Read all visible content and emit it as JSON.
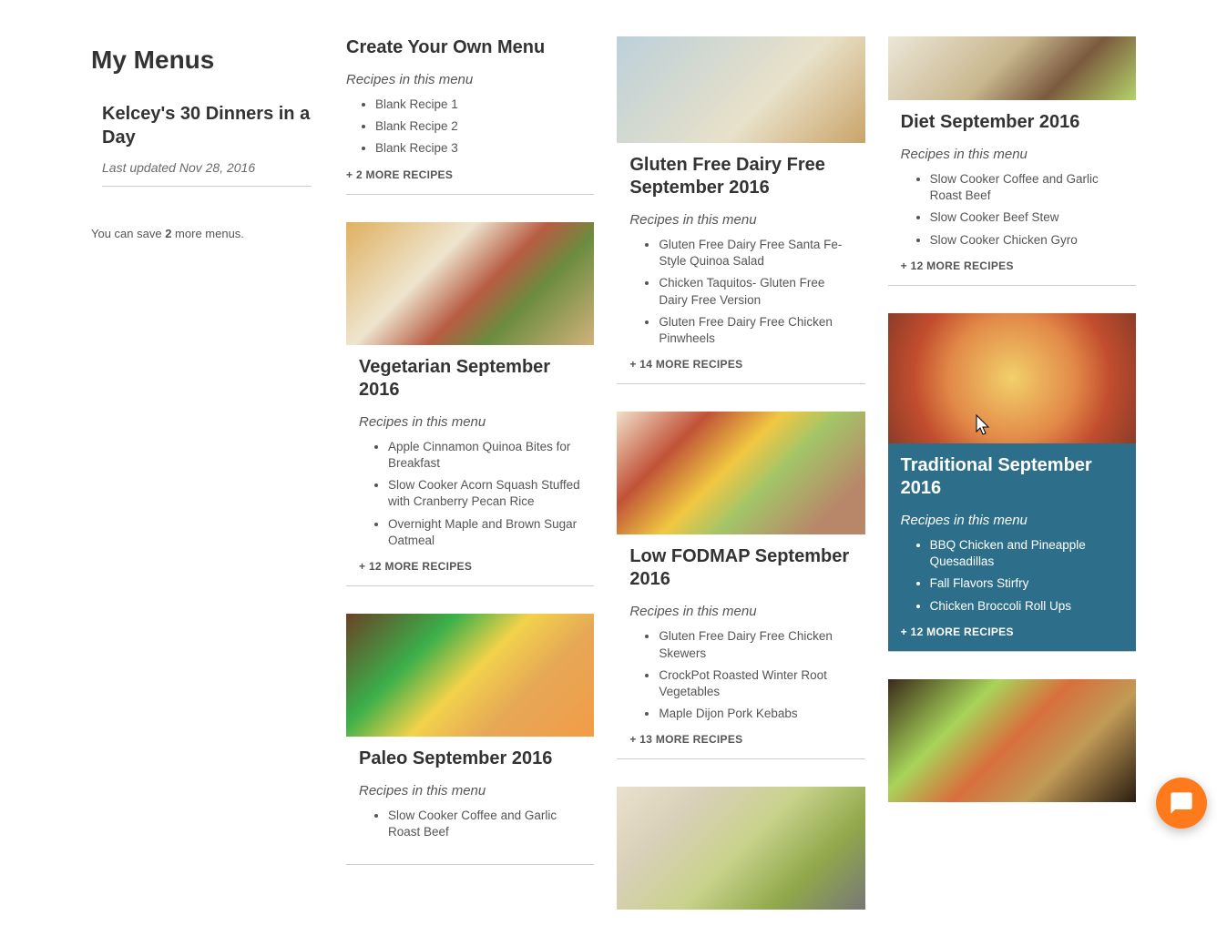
{
  "sidebar": {
    "title": "My Menus",
    "user_menu": {
      "title": "Kelcey's 30 Dinners in a Day",
      "updated": "Last updated Nov 28, 2016"
    },
    "save_note_pre": "You can save ",
    "save_note_count": "2",
    "save_note_post": " more menus."
  },
  "recipes_label": "Recipes in this menu",
  "menus": [
    {
      "id": "create",
      "title": "Create Your Own Menu",
      "recipes": [
        "Blank Recipe 1",
        "Blank Recipe 2",
        "Blank Recipe 3"
      ],
      "more": "+ 2 MORE RECIPES",
      "has_image": false
    },
    {
      "id": "veg",
      "title": "Vegetarian September 2016",
      "recipes": [
        "Apple Cinnamon Quinoa Bites for Breakfast",
        "Slow Cooker Acorn Squash Stuffed with Cranberry Pecan Rice",
        "Overnight Maple and Brown Sugar Oatmeal"
      ],
      "more": "+ 12 MORE RECIPES",
      "has_image": true,
      "img_class": "img-vegbowl"
    },
    {
      "id": "paleo",
      "title": "Paleo September 2016",
      "recipes": [
        "Slow Cooker Coffee and Garlic Roast Beef"
      ],
      "more": "",
      "has_image": true,
      "img_class": "img-eggs"
    },
    {
      "id": "gfdf",
      "title": "Gluten Free Dairy Free September 2016",
      "recipes": [
        "Gluten Free Dairy Free Santa Fe-Style Quinoa Salad",
        "Chicken Taquitos- Gluten Free Dairy Free Version",
        "Gluten Free Dairy Free Chicken Pinwheels"
      ],
      "more": "+ 14 MORE RECIPES",
      "has_image": true,
      "img_class": "img-drinks"
    },
    {
      "id": "fodmap",
      "title": "Low FODMAP September 2016",
      "recipes": [
        "Gluten Free Dairy Free Chicken Skewers",
        "CrockPot Roasted Winter Root Vegetables",
        "Maple Dijon Pork Kebabs"
      ],
      "more": "+ 13 MORE RECIPES",
      "has_image": true,
      "img_class": "img-kebab"
    },
    {
      "id": "soup",
      "title": "",
      "recipes": [],
      "more": "",
      "has_image": true,
      "img_class": "img-soup",
      "image_only": true
    },
    {
      "id": "diet",
      "title": "Diet September 2016",
      "recipes": [
        "Slow Cooker Coffee and Garlic Roast Beef",
        "Slow Cooker Beef Stew",
        "Slow Cooker Chicken Gyro"
      ],
      "more": "+ 12 MORE RECIPES",
      "has_image": true,
      "img_class": "img-roast"
    },
    {
      "id": "trad",
      "title": "Traditional September 2016",
      "recipes": [
        "BBQ Chicken and Pineapple Quesadillas",
        "Fall Flavors Stirfry",
        "Chicken Broccoli Roll Ups"
      ],
      "more": "+ 12 MORE RECIPES",
      "has_image": true,
      "img_class": "img-tomato",
      "hovered": true
    },
    {
      "id": "pasta",
      "title": "",
      "recipes": [],
      "more": "",
      "has_image": true,
      "img_class": "img-pasta",
      "image_only": true
    }
  ]
}
